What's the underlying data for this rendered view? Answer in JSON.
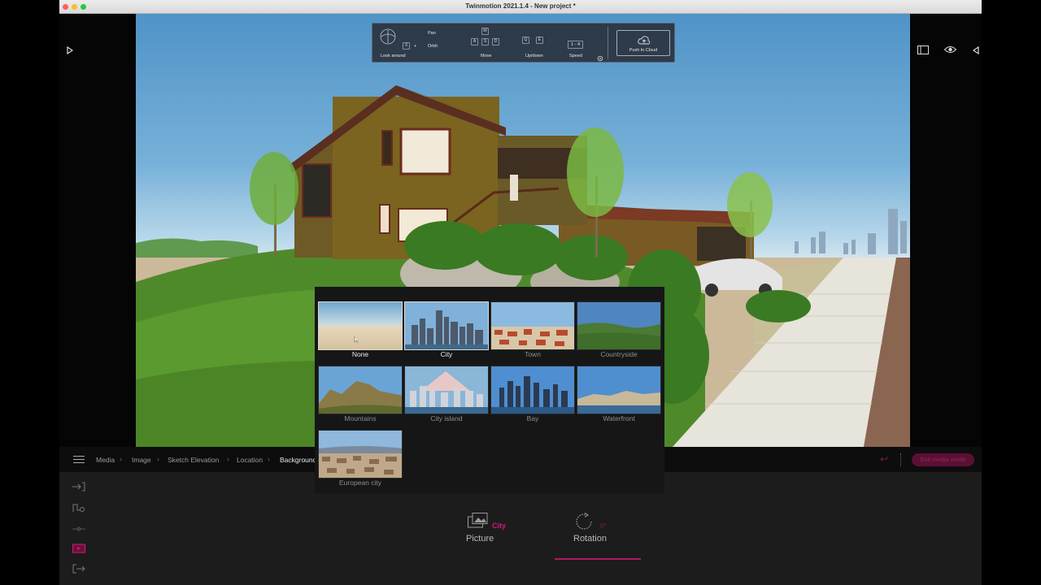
{
  "window": {
    "title": "Twinmotion 2021.1.4 - New project *"
  },
  "nav_toolbar": {
    "look_around": "Look around",
    "pan": "Pan",
    "orbit": "Orbit",
    "move": "Move",
    "updown": "Up/down",
    "speed": "Speed",
    "speed_value": "1 - 4",
    "push_to_cloud": "Push to Cloud",
    "keys": {
      "zero": "0",
      "plus": "+",
      "w": "W",
      "a": "A",
      "s": "S",
      "d": "D",
      "q": "Q",
      "e": "E"
    }
  },
  "background_picker": {
    "items": [
      {
        "label": "None",
        "state": "active"
      },
      {
        "label": "City",
        "state": "selected"
      },
      {
        "label": "Town",
        "state": ""
      },
      {
        "label": "Countryside",
        "state": ""
      },
      {
        "label": "Mountains",
        "state": ""
      },
      {
        "label": "City island",
        "state": ""
      },
      {
        "label": "Bay",
        "state": ""
      },
      {
        "label": "Waterfront",
        "state": ""
      },
      {
        "label": "European city",
        "state": ""
      }
    ]
  },
  "breadcrumb": [
    "Media",
    "Image",
    "Sketch Elevation",
    "Location",
    "Background"
  ],
  "properties": {
    "picture_label": "Picture",
    "picture_value": "City",
    "rotation_label": "Rotation",
    "rotation_value": "0°"
  },
  "exit_button": "Exit media mode",
  "colors": {
    "accent": "#d3197a",
    "panel": "#1c1c1c",
    "picker": "#161616"
  }
}
